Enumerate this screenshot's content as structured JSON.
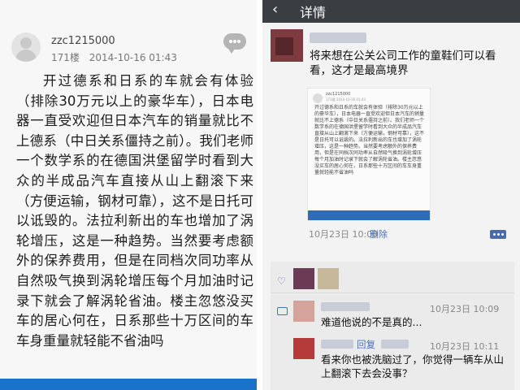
{
  "left_post": {
    "username": "zzc1215000",
    "floor": "171楼",
    "datetime": "2014-10-16 01:43",
    "content": "开过德系和日系的车就会有体验（排除30万元以上的豪华车），日本电器一直受欢迎但日本汽车的销量就比不上德系（中日关系僵持之前）。我们老师一个数学系的在德国洪堡留学时看到大众的半成品汽车直接从山上翻滚下来（方便运输，钢材可靠），这不是日托可以诋毁的。法拉利新出的车也增加了涡轮增压，这是一种趋势。当然要考虑额外的保养费用，但是在同档次同功率从自然吸气换到涡轮增压每个月加油时记录下就会了解涡轮省油。楼主忽悠没买车的居心何在，日系那些十万区间的车车身重量就轻能不省油吗"
  },
  "right_detail": {
    "window_title": "详情",
    "back_glyph": "‹",
    "post_text": "将来想在公关公司工作的童鞋们可以看看，这才是最高境界",
    "post_time": "10月23日 10:00",
    "delete_label": "删除",
    "thumbnail": {
      "username": "zzc1215000",
      "meta": "171楼 2014-10-16 01:43",
      "content": "开过德系和日系的车就会有体验（排除30万元以上的豪华车），日本电器一直受欢迎但日本汽车的销量就比不上德系（中日关系僵持之前）。我们老师一个数学系的在德国洪堡留学时看到大众的半成品汽车直接从山上翻滚下来（方便运输，钢材可靠），这不是日托可以诋毁的。法拉利新出的车也增加了涡轮增压，这是一种趋势。当然要考虑额外的保养费用，但是在同档次同功率从自然吸气换到涡轮增压每个月加油时记录下就会了解涡轮省油。楼主忽悠没买车的居心何在，日系那些十万区间的车车身重量就轻能不省油吗"
    },
    "comments": [
      {
        "time": "10月23日 10:09",
        "text": "难道他说的不是真的...",
        "reply_label": ""
      },
      {
        "time": "10月23日 10:11",
        "text": "看来你也被洗脑过了，你觉得一辆车从山上翻滚下去会没事？",
        "reply_label": "回复"
      }
    ],
    "colors": {
      "topbar": "#3a3d42",
      "link": "#4a6fbf",
      "comment_bg": "#ebebeb"
    }
  }
}
